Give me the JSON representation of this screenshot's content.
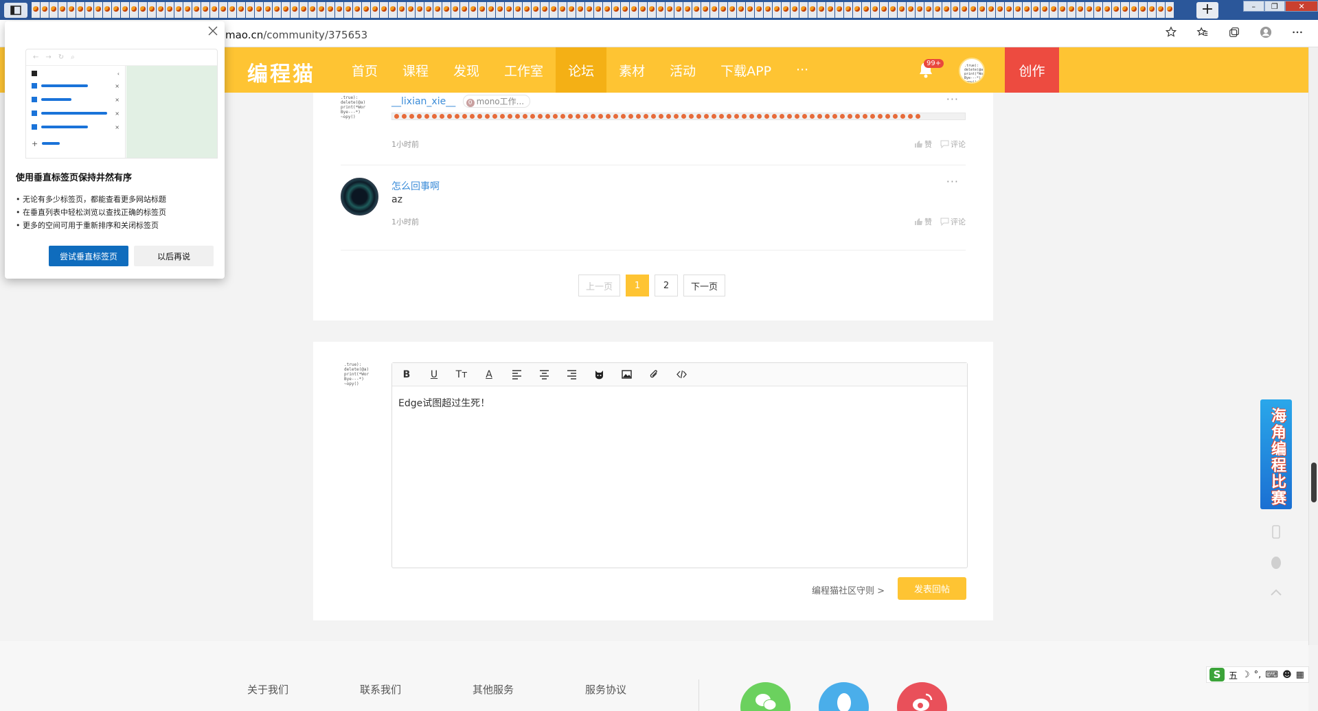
{
  "browser": {
    "url_prefix": "mao.cn",
    "url_path": "/community/375653",
    "new_tab_label": "+",
    "window_controls": [
      "–",
      "❐",
      "✕"
    ]
  },
  "header": {
    "logo": "编程猫",
    "nav": [
      "首页",
      "课程",
      "发现",
      "工作室",
      "论坛",
      "素材",
      "活动",
      "下载APP",
      "···"
    ],
    "active_nav": "论坛",
    "notification_badge": "99+",
    "create_label": "创作",
    "avatar_code": ".true):\ndelete(@a)\nprint(*Wor\nBye---*)\n~opy()"
  },
  "comments": [
    {
      "author": "__lixian_xie__",
      "tag": "mono工作...",
      "tag_icon": "0",
      "text": "",
      "time": "1小时前",
      "like_label": "赞",
      "comment_label": "评论",
      "more": "···",
      "avatar_code": ".true):\ndelete(@a)\nprint(*Wor\nBye---*)\n~opy()"
    },
    {
      "author": "怎么回事啊",
      "text": "az",
      "time": "1小时前",
      "like_label": "赞",
      "comment_label": "评论",
      "more": "···"
    }
  ],
  "pagination": {
    "prev": "上一页",
    "pages": [
      "1",
      "2"
    ],
    "current": "1",
    "next": "下一页"
  },
  "editor": {
    "avatar_code": ".true):\ndelete(@a)\nprint(*Wor\nBye---*)\n~opy()",
    "toolbar_labels": [
      "B",
      "U",
      "Tт",
      "A"
    ],
    "content": "Edge试图超过生死！",
    "rules_link": "编程猫社区守则 >",
    "submit_label": "发表回帖"
  },
  "footer": {
    "links": [
      "关于我们",
      "联系我们",
      "其他服务",
      "服务协议"
    ]
  },
  "side": {
    "promo_text": "海角编程比赛"
  },
  "ime": {
    "logo": "S",
    "mode": "五"
  },
  "popup": {
    "title": "使用垂直标签页保持井然有序",
    "bullets": [
      "无论有多少标签页，都能查看更多网站标题",
      "在垂直列表中轻松浏览以查找正确的标签页",
      "更多的空间可用于重新排序和关闭标签页"
    ],
    "primary_button": "尝试垂直标签页",
    "secondary_button": "以后再说"
  },
  "colors": {
    "brand_yellow": "#fec433",
    "active_nav": "#f4b015",
    "create_red": "#ed4b40",
    "link_blue": "#3b8cd8",
    "popup_primary": "#0f6cbd"
  }
}
